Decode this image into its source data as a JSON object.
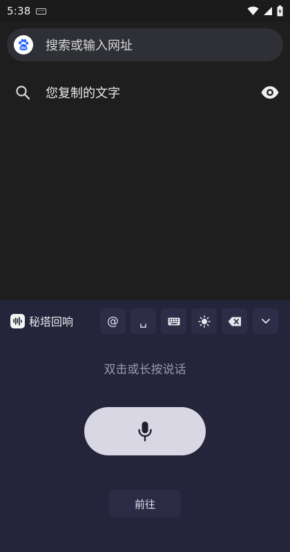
{
  "status_bar": {
    "time": "5:38",
    "icons": [
      "keyboard-indicator-icon",
      "wifi-icon",
      "signal-icon",
      "battery-charging-icon"
    ]
  },
  "search": {
    "placeholder": "搜索或输入网址",
    "engine_icon": "baidu-paw-icon"
  },
  "suggestion": {
    "icon": "search-icon",
    "text": "您复制的文字",
    "action_icon": "eye-icon"
  },
  "keyboard": {
    "brand_name": "秘塔回响",
    "brand_icon": "soundwave-icon",
    "keys": {
      "at_label": "@",
      "space_label": "␣",
      "icons": [
        "keyboard-icon",
        "brightness-icon",
        "backspace-icon",
        "chevron-down-icon"
      ]
    },
    "hint": "双击或长按说话",
    "mic_icon": "microphone-icon",
    "go_label": "前往"
  },
  "colors": {
    "page_bg": "#1e1e1e",
    "search_bg": "#2e3035",
    "keyboard_bg": "#24243a",
    "key_bg": "#2d2d47",
    "mic_bg": "#d8d7e3",
    "engine_blue": "#2b63ff"
  }
}
